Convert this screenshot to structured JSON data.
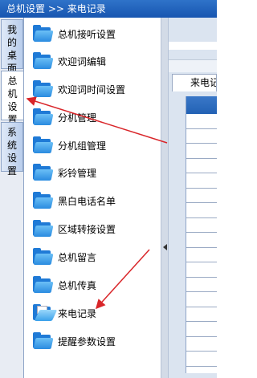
{
  "breadcrumb": {
    "section": "总机设置",
    "separator": ">>",
    "page": "来电记录"
  },
  "side_tabs": [
    {
      "label": "我的桌面"
    },
    {
      "label": "总机设置",
      "active": true
    },
    {
      "label": "系统设置"
    }
  ],
  "menu": {
    "items": [
      {
        "label": "总机接听设置",
        "icon": "folder-icon"
      },
      {
        "label": "欢迎词编辑",
        "icon": "folder-icon"
      },
      {
        "label": "欢迎词时间设置",
        "icon": "folder-icon"
      },
      {
        "label": "分机管理",
        "icon": "folder-icon"
      },
      {
        "label": "分机组管理",
        "icon": "folder-icon"
      },
      {
        "label": "彩铃管理",
        "icon": "folder-icon"
      },
      {
        "label": "黑白电话名单",
        "icon": "folder-icon"
      },
      {
        "label": "区域转接设置",
        "icon": "folder-icon"
      },
      {
        "label": "总机留言",
        "icon": "folder-icon"
      },
      {
        "label": "总机传真",
        "icon": "folder-icon"
      },
      {
        "label": "来电记录",
        "icon": "folder-open-icon",
        "selected": true
      },
      {
        "label": "提醒参数设置",
        "icon": "folder-icon"
      }
    ]
  },
  "content": {
    "tab_label": "来电记"
  },
  "colors": {
    "titlebar": "#1f5fbf",
    "header": "#2a66b8",
    "folder": "#1f7ad6",
    "arrow": "#d9262a"
  }
}
